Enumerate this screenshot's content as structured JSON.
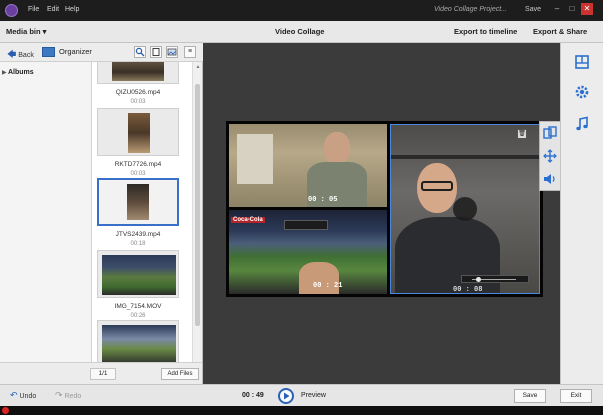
{
  "titlebar": {
    "menus": [
      "File",
      "Edit",
      "Help"
    ],
    "window_title": "Video Collage Project...",
    "save_label": "Save"
  },
  "header": {
    "media_bin": "Media bin ▾",
    "title": "Video Collage",
    "export_timeline": "Export to timeline",
    "export_share": "Export & Share"
  },
  "left": {
    "back": "Back",
    "organizer": "Organizer",
    "albums": "Albums",
    "page": "1/1",
    "add_files": "Add Files"
  },
  "media": [
    {
      "name": "QIZU0526.mp4",
      "duration": "00:03"
    },
    {
      "name": "RKTD7726.mp4",
      "duration": "00:03"
    },
    {
      "name": "JTVS2439.mp4",
      "duration": "00:18"
    },
    {
      "name": "IMG_7154.MOV",
      "duration": "00:26"
    },
    {
      "name": "",
      "duration": ""
    }
  ],
  "collage": {
    "timecodes": [
      "00 : 05",
      "00 : 21",
      "00 : 08"
    ],
    "scoreboard_text": "Coca-Cola"
  },
  "bottom": {
    "undo": "Undo",
    "redo": "Redo",
    "timecode": "00 : 49",
    "preview": "Preview",
    "save": "Save",
    "exit": "Exit"
  },
  "colors": {
    "accent": "#3a6fc9",
    "selection_border": "#4a88e0",
    "canvas_bg": "#3b3b3b",
    "titlebar_bg": "#1d1d1d"
  },
  "icons": [
    "app-logo-icon",
    "minimize-icon",
    "maximize-icon",
    "close-icon",
    "back-arrow-icon",
    "organizer-icon",
    "search-icon",
    "view-icon",
    "image-icon",
    "menu-icon",
    "collapse-arrow-icon",
    "layout-icon",
    "gear-icon",
    "music-note-icon",
    "swap-icon",
    "move-icon",
    "volume-icon",
    "undo-icon",
    "redo-icon",
    "play-icon",
    "delete-icon"
  ]
}
